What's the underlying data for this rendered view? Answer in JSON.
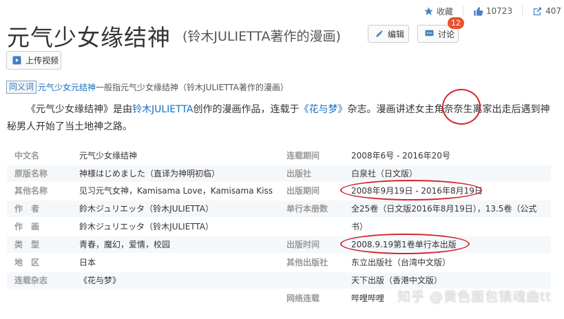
{
  "topbar": {
    "collect": "收藏",
    "likes": "10723",
    "shares": "407"
  },
  "header": {
    "title": "元气少女缘结神",
    "subtitle": "(铃木JULIETTA著作的漫画)",
    "edit_label": "编辑",
    "discuss_label": "讨论",
    "discuss_badge": "12",
    "upload_label": "上传视频"
  },
  "synonym": {
    "tag": "同义词",
    "term": "元气少女元结神",
    "mid": "一般指",
    "target": "元气少女缘结神（铃木JULIETTA著作的漫画）"
  },
  "summary": {
    "p1": "《元气少女缘结神》是由",
    "author_link": "铃木JULIETTA",
    "p2": "创作的漫画作品，连载于",
    "mag_link": "《花与梦》",
    "p3": "杂志。漫画讲述女主角奈奈生离家出走后遇到神秘男人开始了当土地神之路。"
  },
  "info_left": [
    {
      "k": "中文名",
      "v": "元气少女缘结神"
    },
    {
      "k": "原版名称",
      "v": "神様はじめました（直译为神明初临）"
    },
    {
      "k": "其他名称",
      "v": "见习元气女神，Kamisama Love，Kamisama Kiss"
    },
    {
      "k": "作　者",
      "v": "鈴木ジュリエッタ（铃木JULIETTA）"
    },
    {
      "k": "作　画",
      "v": "鈴木ジュリエッタ（铃木JULIETTA）"
    },
    {
      "k": "类　型",
      "v": "青春，魔幻，爱情，校园"
    },
    {
      "k": "地　区",
      "v": "日本"
    },
    {
      "k": "连载杂志",
      "v": "《花与梦》"
    }
  ],
  "info_right": [
    {
      "k": "连载期间",
      "v": "2008年6号 - 2016年20号"
    },
    {
      "k": "出版社",
      "v": "白泉社（日文版）"
    },
    {
      "k": "出版期间",
      "v": "2008年9月19日 - 2016年8月19日"
    },
    {
      "k": "单行本册数",
      "v": "全25卷（日文版2016年8月19日），13.5卷（公式"
    },
    {
      "k": "",
      "v": "书）"
    },
    {
      "k": "出版时间",
      "v": "2008.9.19第1卷单行本出版"
    },
    {
      "k": "其他出版社",
      "v": "东立出版社（台湾中文版）"
    },
    {
      "k": "",
      "v": "天下出版（香港中文版）"
    },
    {
      "k": "网络连载",
      "v": "哔哩哔哩"
    }
  ],
  "watermark": "知乎 @黄色面包镇魂曲tt",
  "colors": {
    "link": "#136ec2",
    "annotation": "#d4252e",
    "badge": "#e8522b"
  }
}
